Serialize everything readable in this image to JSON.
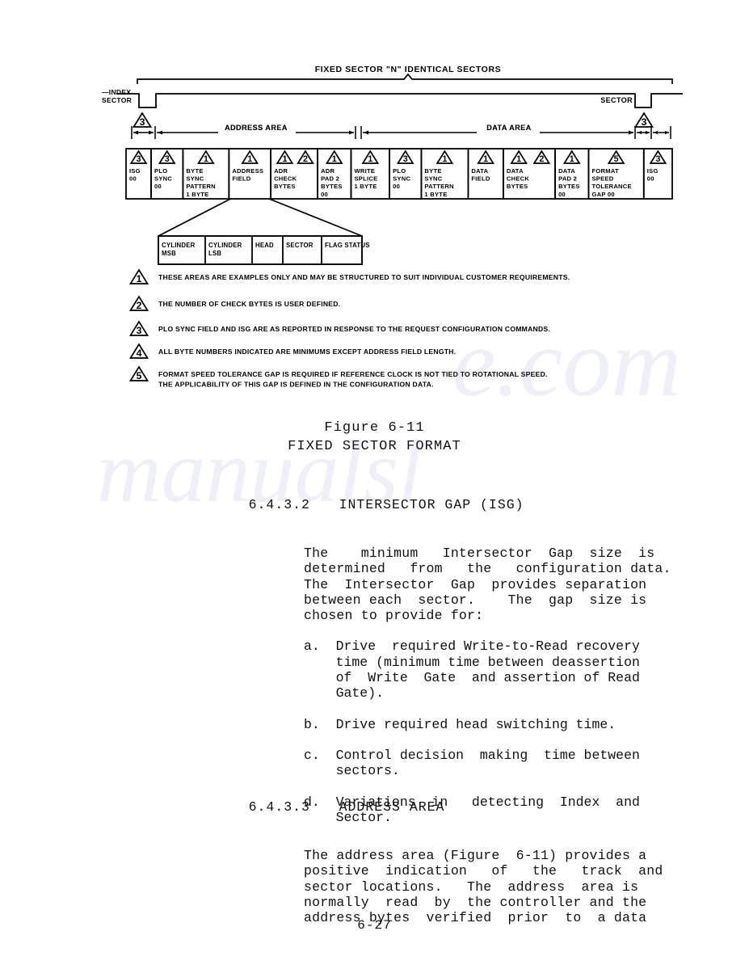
{
  "page": {
    "number": "6-27"
  },
  "figure": {
    "top_title": "FIXED SECTOR \"N\" IDENTICAL SECTORS",
    "left_label_line1": "—INDEX",
    "left_label_line2": "SECTOR",
    "right_label": "SECTOR",
    "left_note_marker": "3",
    "right_note_marker": "3",
    "dim_address_area": "ADDRESS AREA",
    "dim_data_area": "DATA AREA",
    "fields": [
      {
        "marker": "3",
        "lines": [
          "ISG",
          "00"
        ]
      },
      {
        "marker": "3",
        "lines": [
          "PLO",
          "SYNC",
          "00"
        ]
      },
      {
        "marker": "1",
        "lines": [
          "BYTE",
          "SYNC",
          "PATTERN",
          "1 BYTE"
        ]
      },
      {
        "marker": "1",
        "lines": [
          "ADDRESS",
          "FIELD"
        ]
      },
      {
        "marker": "1",
        "marker2": "2",
        "lines": [
          "ADR",
          "CHECK",
          "BYTES"
        ]
      },
      {
        "marker": "1",
        "lines": [
          "ADR",
          "PAD 2",
          "BYTES",
          "00"
        ]
      },
      {
        "marker": "1",
        "lines": [
          "WRITE",
          "SPLICE",
          "1 BYTE"
        ]
      },
      {
        "marker": "3",
        "lines": [
          "PLO",
          "SYNC",
          "00"
        ]
      },
      {
        "marker": "1",
        "lines": [
          "BYTE",
          "SYNC",
          "PATTERN",
          "1 BYTE"
        ]
      },
      {
        "marker": "1",
        "lines": [
          "DATA",
          "FIELD"
        ]
      },
      {
        "marker": "1",
        "marker2": "2",
        "lines": [
          "DATA",
          "CHECK",
          "BYTES"
        ]
      },
      {
        "marker": "1",
        "lines": [
          "DATA",
          "PAD 2",
          "BYTES",
          "00"
        ]
      },
      {
        "marker": "5",
        "lines": [
          "FORMAT",
          "SPEED",
          "TOLERANCE",
          "GAP  00"
        ]
      },
      {
        "marker": "3",
        "lines": [
          "ISG",
          "00"
        ]
      }
    ],
    "address_detail": [
      {
        "lines": [
          "CYLINDER",
          "MSB"
        ]
      },
      {
        "lines": [
          "CYLINDER",
          "LSB"
        ]
      },
      {
        "lines": [
          "HEAD"
        ]
      },
      {
        "lines": [
          "SECTOR"
        ]
      },
      {
        "lines": [
          "FLAG  STATUS"
        ]
      }
    ],
    "notes": [
      {
        "marker": "1",
        "lines": [
          "THESE AREAS ARE EXAMPLES ONLY AND MAY BE STRUCTURED TO SUIT INDIVIDUAL CUSTOMER REQUIREMENTS."
        ]
      },
      {
        "marker": "2",
        "lines": [
          "THE NUMBER OF CHECK BYTES IS USER DEFINED."
        ]
      },
      {
        "marker": "3",
        "lines": [
          "PLO SYNC FIELD AND ISG ARE AS REPORTED IN RESPONSE TO THE REQUEST CONFIGURATION COMMANDS."
        ]
      },
      {
        "marker": "4",
        "lines": [
          "ALL BYTE NUMBERS INDICATED ARE MINIMUMS EXCEPT ADDRESS FIELD LENGTH."
        ]
      },
      {
        "marker": "5",
        "lines": [
          "FORMAT SPEED TOLERANCE GAP IS REQUIRED IF REFERENCE CLOCK IS NOT TIED TO ROTATIONAL SPEED.",
          "THE APPLICABILITY OF THIS GAP IS DEFINED IN THE CONFIGURATION DATA."
        ]
      }
    ],
    "caption_line1": "Figure 6-11",
    "caption_line2": "FIXED SECTOR FORMAT"
  },
  "sections": [
    {
      "number": "6.4.3.2",
      "title": "INTERSECTOR GAP (ISG)",
      "paragraph": [
        "The    minimum   Intersector  Gap  size  is",
        "determined   from   the   configuration data.",
        "The  Intersector  Gap  provides separation",
        "between each  sector.    The  gap  size is",
        "chosen to provide for:"
      ],
      "items": [
        [
          "a.  Drive  required Write-to-Read recovery",
          "    time (minimum time between deassertion",
          "    of  Write  Gate  and assertion of Read",
          "    Gate)."
        ],
        [
          "b.  Drive required head switching time."
        ],
        [
          "c.  Control decision  making  time between",
          "    sectors."
        ],
        [
          "d.  Variations  in   detecting  Index  and",
          "    Sector."
        ]
      ]
    },
    {
      "number": "6.4.3.3",
      "title": "ADDRESS AREA",
      "paragraph": [
        "The address area (Figure  6-11) provides a",
        "positive  indication   of   the   track  and",
        "sector locations.   The  address  area is",
        "normally  read  by  the controller and the",
        "address bytes  verified  prior  to  a data"
      ],
      "items": []
    }
  ]
}
